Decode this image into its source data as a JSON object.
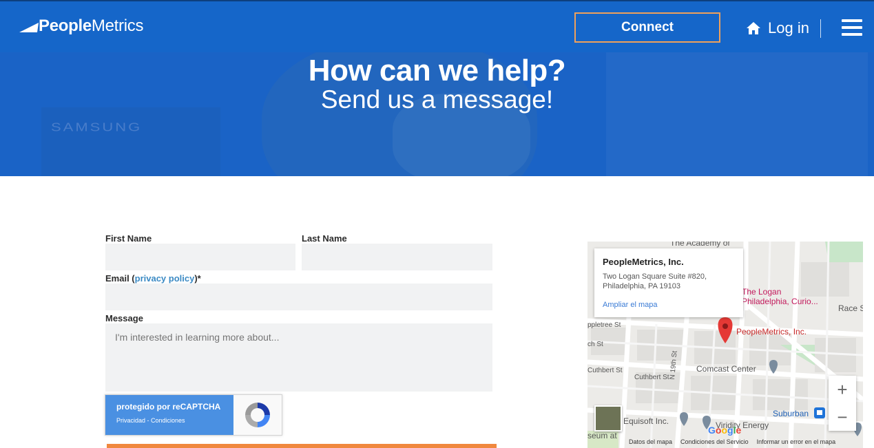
{
  "header": {
    "logo_bold": "People",
    "logo_light": "Metrics",
    "connect_label": "Connect",
    "login_label": "Log in",
    "icons": {
      "home": "home-icon",
      "menu": "hamburger-menu-icon"
    }
  },
  "hero": {
    "title": "How can we help?",
    "subtitle": "Send us a message!",
    "background_text": "SAMSUNG"
  },
  "form": {
    "first_name_label": "First Name",
    "last_name_label": "Last Name",
    "email_label_prefix": "Email (",
    "email_link": "privacy policy",
    "email_label_suffix": ")*",
    "message_label": "Message",
    "message_placeholder": "I'm interested in learning more about...",
    "first_name_value": "",
    "last_name_value": "",
    "email_value": ""
  },
  "recaptcha": {
    "line1": "protegido por reCAPTCHA",
    "line2": "Privacidad - Condiciones"
  },
  "map": {
    "place_name": "PeopleMetrics, Inc.",
    "address_line1": "Two Logan Square Suite #820,",
    "address_line2": "Philadelphia, PA 19103",
    "enlarge_link": "Ampliar el mapa",
    "labels": {
      "academy": "The Academy of",
      "logan": "The Logan",
      "logan2": "Philadelphia, Curio...",
      "race": "Race S",
      "appletree": "ppletree St",
      "cherry": "ch St",
      "cuthbert1": "Cuthbert St",
      "cuthbert2": "Cuthbert St",
      "n19th": "N 19th St",
      "pin_label": "PeopleMetrics, Inc.",
      "comcast": "Comcast Center",
      "suburban": "Suburban",
      "equisoft": "Equisoft Inc.",
      "viridity": "Viridity Energy",
      "museum": "seum at"
    },
    "footer": {
      "data": "Datos del mapa",
      "terms": "Condiciones del Servicio",
      "report": "Informar un error en el mapa"
    },
    "google": "Google",
    "zoom_in": "+",
    "zoom_out": "−"
  },
  "colors": {
    "header_bg": "#1566c9",
    "hero_bg": "#1a63c6",
    "connect_border": "#f0a15a",
    "submit": "#f0883e",
    "recaptcha_blue": "#4a90e2",
    "pin_red": "#e53935"
  }
}
